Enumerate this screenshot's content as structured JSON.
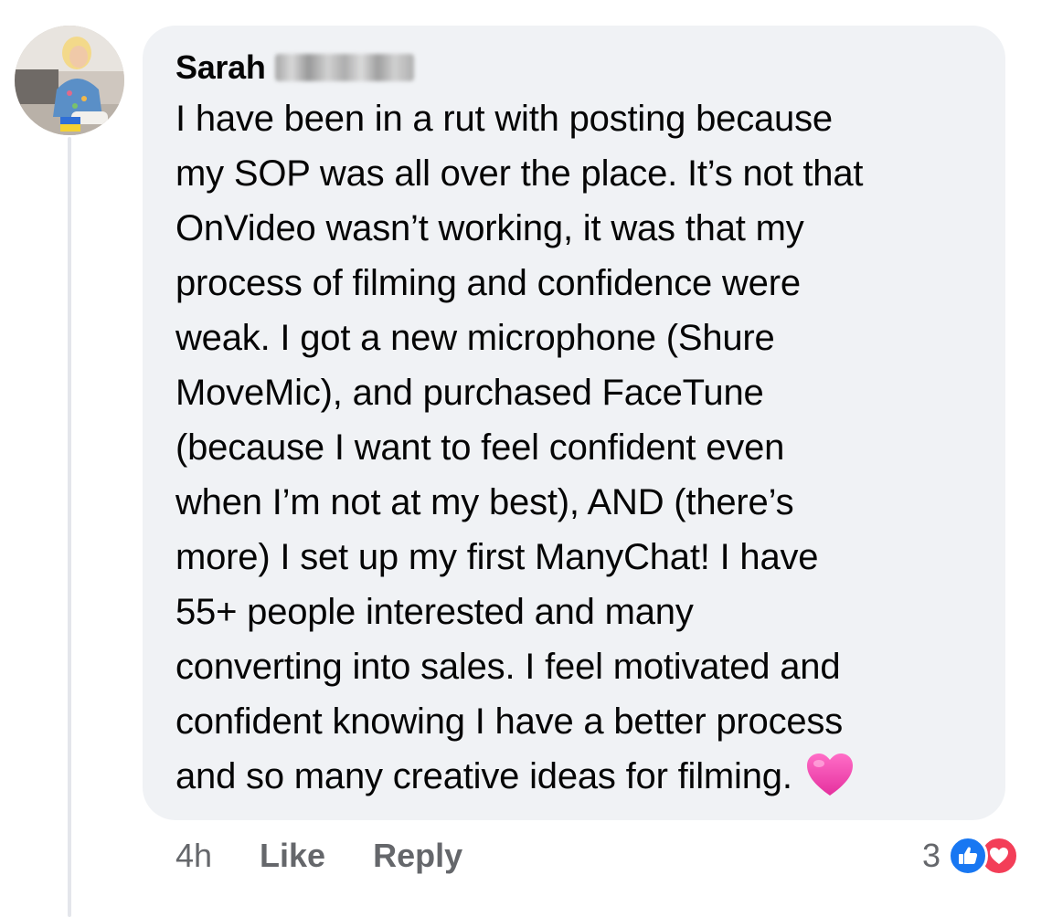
{
  "comment": {
    "author": "Sarah",
    "lines": [
      "I have been in a rut with posting because",
      "my SOP was all over the place. It’s not that",
      "OnVideo wasn’t working, it was that my",
      "process of filming and confidence were",
      "weak. I got a new microphone (Shure",
      "MoveMic), and purchased FaceTune",
      "(because I want to feel confident even",
      "when I’m not at my best), AND (there’s"
    ],
    "line9_plain": "more) ",
    "line9_highlight": "I set up my first ManyChat! I have",
    "line10_highlight": "55+ people interested and many",
    "line11_highlight": "converting into sales",
    "line11_rest": ". I feel motivated and",
    "line12": "confident knowing I have a better process",
    "line13": "and so many creative ideas for filming.",
    "emoji": "pink-heart"
  },
  "footer": {
    "time": "4h",
    "like_label": "Like",
    "reply_label": "Reply",
    "reaction_count": "3",
    "reactions": [
      "like",
      "love"
    ]
  },
  "colors": {
    "bubble": "#f0f2f5",
    "highlight": "#c9d92a",
    "meta_text": "#65676b",
    "like_blue": "#1877f2",
    "love_red": "#f33e58"
  }
}
